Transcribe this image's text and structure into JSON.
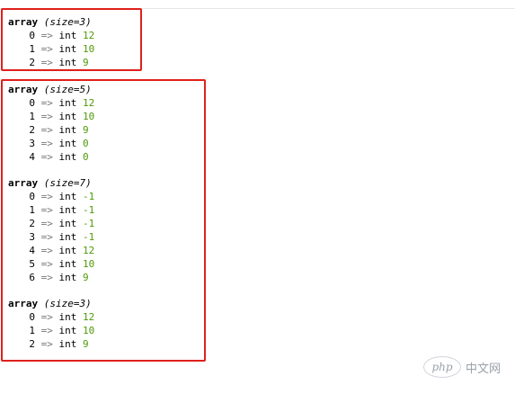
{
  "dumps": [
    {
      "header_keyword": "array",
      "header_size": "(size=3)",
      "items": [
        {
          "index": "0",
          "arrow": "=>",
          "type": "int",
          "value": "12"
        },
        {
          "index": "1",
          "arrow": "=>",
          "type": "int",
          "value": "10"
        },
        {
          "index": "2",
          "arrow": "=>",
          "type": "int",
          "value": "9"
        }
      ]
    },
    {
      "header_keyword": "array",
      "header_size": "(size=5)",
      "items": [
        {
          "index": "0",
          "arrow": "=>",
          "type": "int",
          "value": "12"
        },
        {
          "index": "1",
          "arrow": "=>",
          "type": "int",
          "value": "10"
        },
        {
          "index": "2",
          "arrow": "=>",
          "type": "int",
          "value": "9"
        },
        {
          "index": "3",
          "arrow": "=>",
          "type": "int",
          "value": "0"
        },
        {
          "index": "4",
          "arrow": "=>",
          "type": "int",
          "value": "0"
        }
      ]
    },
    {
      "header_keyword": "array",
      "header_size": "(size=7)",
      "items": [
        {
          "index": "0",
          "arrow": "=>",
          "type": "int",
          "value": "-1"
        },
        {
          "index": "1",
          "arrow": "=>",
          "type": "int",
          "value": "-1"
        },
        {
          "index": "2",
          "arrow": "=>",
          "type": "int",
          "value": "-1"
        },
        {
          "index": "3",
          "arrow": "=>",
          "type": "int",
          "value": "-1"
        },
        {
          "index": "4",
          "arrow": "=>",
          "type": "int",
          "value": "12"
        },
        {
          "index": "5",
          "arrow": "=>",
          "type": "int",
          "value": "10"
        },
        {
          "index": "6",
          "arrow": "=>",
          "type": "int",
          "value": "9"
        }
      ]
    },
    {
      "header_keyword": "array",
      "header_size": "(size=3)",
      "items": [
        {
          "index": "0",
          "arrow": "=>",
          "type": "int",
          "value": "12"
        },
        {
          "index": "1",
          "arrow": "=>",
          "type": "int",
          "value": "10"
        },
        {
          "index": "2",
          "arrow": "=>",
          "type": "int",
          "value": "9"
        }
      ]
    }
  ],
  "colors": {
    "highlight_border": "#e0201b",
    "int_value": "#4e9a06",
    "arrow": "#777777"
  },
  "watermark": {
    "logo_text": "php",
    "site_text": "中文网"
  }
}
